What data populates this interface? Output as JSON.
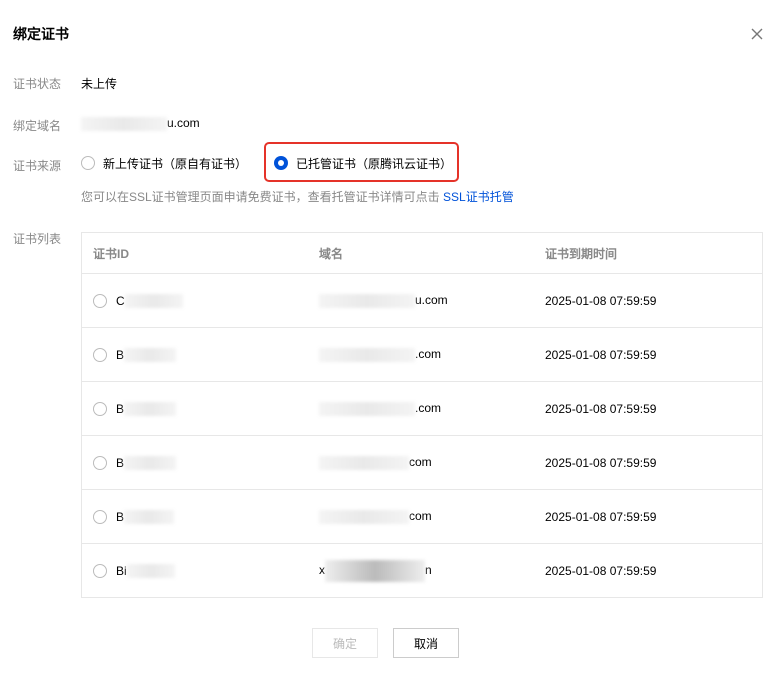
{
  "dialog": {
    "title": "绑定证书"
  },
  "status": {
    "label": "证书状态",
    "value": "未上传"
  },
  "domain": {
    "label": "绑定域名",
    "value_suffix": "u.com"
  },
  "source": {
    "label": "证书来源",
    "options": [
      {
        "label": "新上传证书（原自有证书）",
        "checked": false
      },
      {
        "label": "已托管证书（原腾讯云证书）",
        "checked": true
      }
    ]
  },
  "hint": {
    "text": "您可以在SSL证书管理页面申请免费证书，查看托管证书详情可点击",
    "link": "SSL证书托管"
  },
  "list": {
    "label": "证书列表",
    "columns": [
      "证书ID",
      "域名",
      "证书到期时间"
    ],
    "rows": [
      {
        "id_prefix": "C",
        "domain_prefix": "",
        "domain_suffix": "u.com",
        "expires": "2025-01-08 07:59:59"
      },
      {
        "id_prefix": "B",
        "domain_prefix": "",
        "domain_suffix": ".com",
        "expires": "2025-01-08 07:59:59"
      },
      {
        "id_prefix": "B",
        "domain_prefix": "",
        "domain_suffix": ".com",
        "expires": "2025-01-08 07:59:59"
      },
      {
        "id_prefix": "B",
        "domain_prefix": "",
        "domain_suffix": "com",
        "expires": "2025-01-08 07:59:59"
      },
      {
        "id_prefix": "B",
        "domain_prefix": "",
        "domain_suffix": "com",
        "expires": "2025-01-08 07:59:59"
      },
      {
        "id_prefix": "Bi",
        "domain_prefix": "x",
        "domain_suffix": "n",
        "expires": "2025-01-08 07:59:59"
      }
    ]
  },
  "buttons": {
    "confirm": "确定",
    "cancel": "取消"
  },
  "colors": {
    "accent": "#0052d9",
    "highlight": "#e53329"
  }
}
